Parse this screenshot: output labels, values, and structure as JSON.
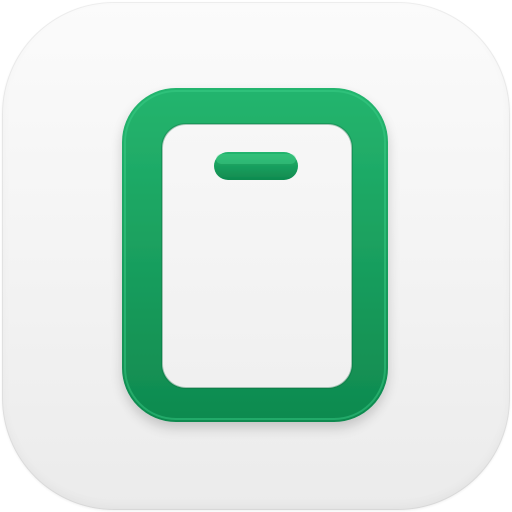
{
  "app_icon": {
    "glyph": "tablet-icon",
    "colors": {
      "accent": "#149a5a",
      "accent_light": "#2cc17a",
      "accent_dark": "#0d7a45",
      "background_top": "#fbfbfb",
      "background_bottom": "#ebebeb",
      "inner_screen": "#f4f4f4"
    }
  }
}
